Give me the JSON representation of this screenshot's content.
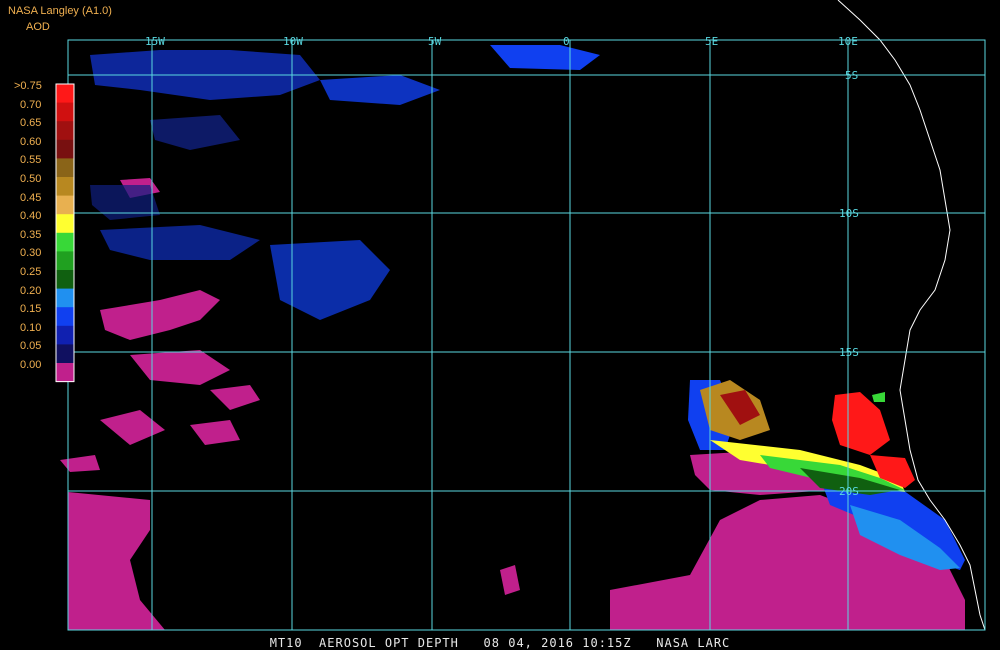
{
  "header": {
    "source": "NASA Langley (A1.0)",
    "product": "AOD"
  },
  "legend": {
    "labels": [
      ">0.75",
      "0.70",
      "0.65",
      "0.60",
      "0.55",
      "0.50",
      "0.45",
      "0.40",
      "0.35",
      "0.30",
      "0.25",
      "0.20",
      "0.15",
      "0.10",
      "0.05",
      "0.00"
    ],
    "colors": [
      "#ff1818",
      "#d01010",
      "#a01010",
      "#781010",
      "#8a6418",
      "#b88820",
      "#e8b050",
      "#ffff30",
      "#38d838",
      "#20a020",
      "#106010",
      "#2090f0",
      "#1040f0",
      "#1020b0",
      "#101060",
      "#c0208c"
    ]
  },
  "grid": {
    "lon_labels": [
      "15W",
      "10W",
      "5W",
      "0",
      "5E",
      "10E"
    ],
    "lat_labels": [
      "5S",
      "10S",
      "15S",
      "20S"
    ]
  },
  "footer": "MT10  AEROSOL OPT DEPTH   08 04, 2016 10:15Z   NASA LARC",
  "colors": {
    "grid": "#5ad8e0",
    "clear_sky": "#c0208c",
    "coast": "#ffffff",
    "background": "#000000"
  }
}
